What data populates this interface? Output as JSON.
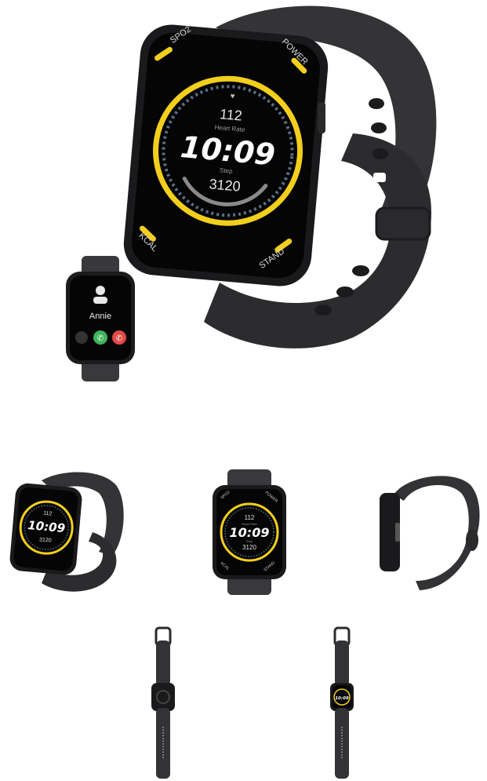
{
  "main_watch": {
    "labels": {
      "spo2": "SPO2",
      "power": "POWER",
      "kcal": "KCAL",
      "stand": "STAND"
    },
    "heart_rate": "112",
    "heart_rate_label": "Heart Rate",
    "time": "10:09",
    "steps_label": "Step",
    "steps": "3120"
  },
  "call_watch": {
    "caller_name": "Annie"
  },
  "thumbs": {
    "front": {
      "labels": {
        "spo2": "SPO2",
        "power": "POWER",
        "kcal": "KCAL",
        "stand": "STAND"
      },
      "heart_rate": "112",
      "heart_rate_label": "Heart Rate",
      "time": "10:09",
      "steps_label": "Step",
      "steps": "3120"
    },
    "angle": {
      "time": "10:09",
      "heart_rate": "112",
      "steps": "3120"
    },
    "flat_on": {
      "time": "10:09"
    }
  },
  "colors": {
    "strap": "#2f2f31",
    "strap_light": "#3d3d40",
    "bezel": "#1a1a1c",
    "screen": "#050505",
    "accent_yellow": "#f2cf1d",
    "ring_blue": "#5a6f86",
    "call_green": "#3fb55b",
    "call_red": "#e24a45"
  },
  "icons": {
    "caller": "person-icon",
    "mute": "mute-icon",
    "accept": "phone-accept-icon",
    "decline": "phone-decline-icon"
  }
}
